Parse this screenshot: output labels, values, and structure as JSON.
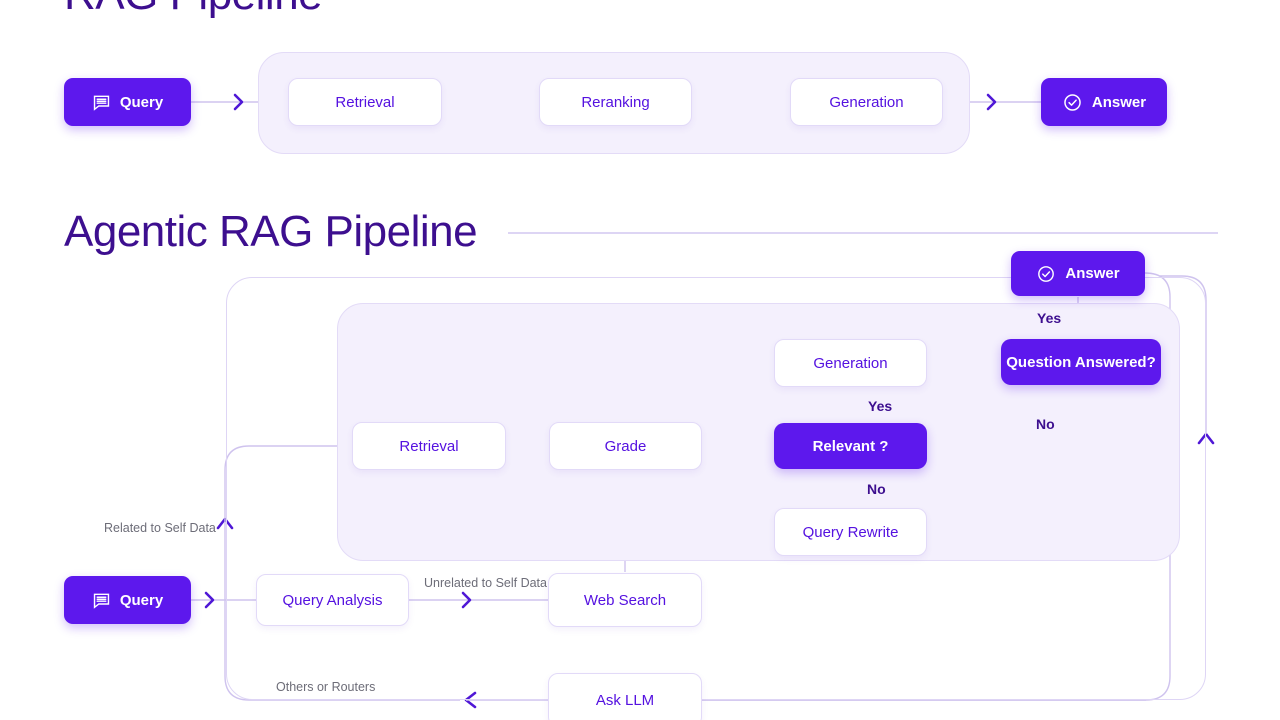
{
  "sections": {
    "top": {
      "title": "RAG Pipeline",
      "query_label": "Query",
      "query_icon": "chat-lines-icon",
      "answer_label": "Answer",
      "answer_icon": "check-circle-icon",
      "stages": [
        "Retrieval",
        "Reranking",
        "Generation"
      ]
    },
    "bottom": {
      "title": "Agentic RAG Pipeline",
      "query_label": "Query",
      "query_icon": "chat-lines-icon",
      "answer_label": "Answer",
      "answer_icon": "check-circle-icon",
      "nodes": {
        "query_analysis": "Query Analysis",
        "web_search": "Web Search",
        "ask_llm": "Ask LLM",
        "retrieval": "Retrieval",
        "grade": "Grade",
        "relevant": "Relevant ?",
        "generation": "Generation",
        "question_answered": "Question Answered?",
        "query_rewrite": "Query Rewrite"
      },
      "edge_labels": {
        "related_self_data": "Related to Self Data",
        "unrelated_self_data": "Unrelated to Self Data",
        "others_or_routers": "Others or Routers",
        "relevant_yes": "Yes",
        "relevant_no": "No",
        "answered_yes": "Yes",
        "answered_no": "No"
      }
    }
  },
  "colors": {
    "accent": "#5d18ed",
    "title": "#3d0f8f",
    "panel_fill": "#f4f0fd",
    "panel_border": "#e3dbf7",
    "wire": "#cfc3ee",
    "arrow": "#5512e0",
    "muted_text": "#6d6d78"
  }
}
